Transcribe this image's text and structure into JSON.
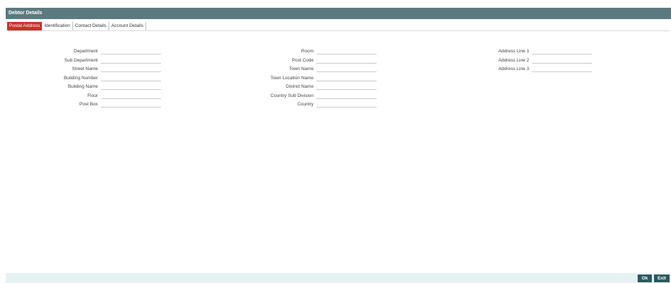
{
  "window": {
    "title": "Debtor Details"
  },
  "tabs": [
    {
      "label": "Postal Address"
    },
    {
      "label": "Identification"
    },
    {
      "label": "Contact Details"
    },
    {
      "label": "Account Details"
    }
  ],
  "form": {
    "col1": [
      {
        "label": "Department",
        "value": ""
      },
      {
        "label": "Sub Department",
        "value": ""
      },
      {
        "label": "Street Name",
        "value": ""
      },
      {
        "label": "Building Number",
        "value": ""
      },
      {
        "label": "Building Name",
        "value": ""
      },
      {
        "label": "Floor",
        "value": ""
      },
      {
        "label": "Post Box",
        "value": ""
      }
    ],
    "col2": [
      {
        "label": "Room",
        "value": ""
      },
      {
        "label": "Post Code",
        "value": ""
      },
      {
        "label": "Town Name",
        "value": ""
      },
      {
        "label": "Town Location Name",
        "value": ""
      },
      {
        "label": "District Name",
        "value": ""
      },
      {
        "label": "Country Sub Division",
        "value": ""
      },
      {
        "label": "Country",
        "value": ""
      }
    ],
    "col3": [
      {
        "label": "Address Line 1",
        "value": ""
      },
      {
        "label": "Address Line 2",
        "value": ""
      },
      {
        "label": "Address Line 3",
        "value": ""
      }
    ]
  },
  "footer": {
    "ok_label": "Ok",
    "exit_label": "Exit"
  },
  "colors": {
    "titlebar": "#5b7a80",
    "active_tab": "#c8322a",
    "button": "#2d5961",
    "footer": "#e6f2f4"
  }
}
